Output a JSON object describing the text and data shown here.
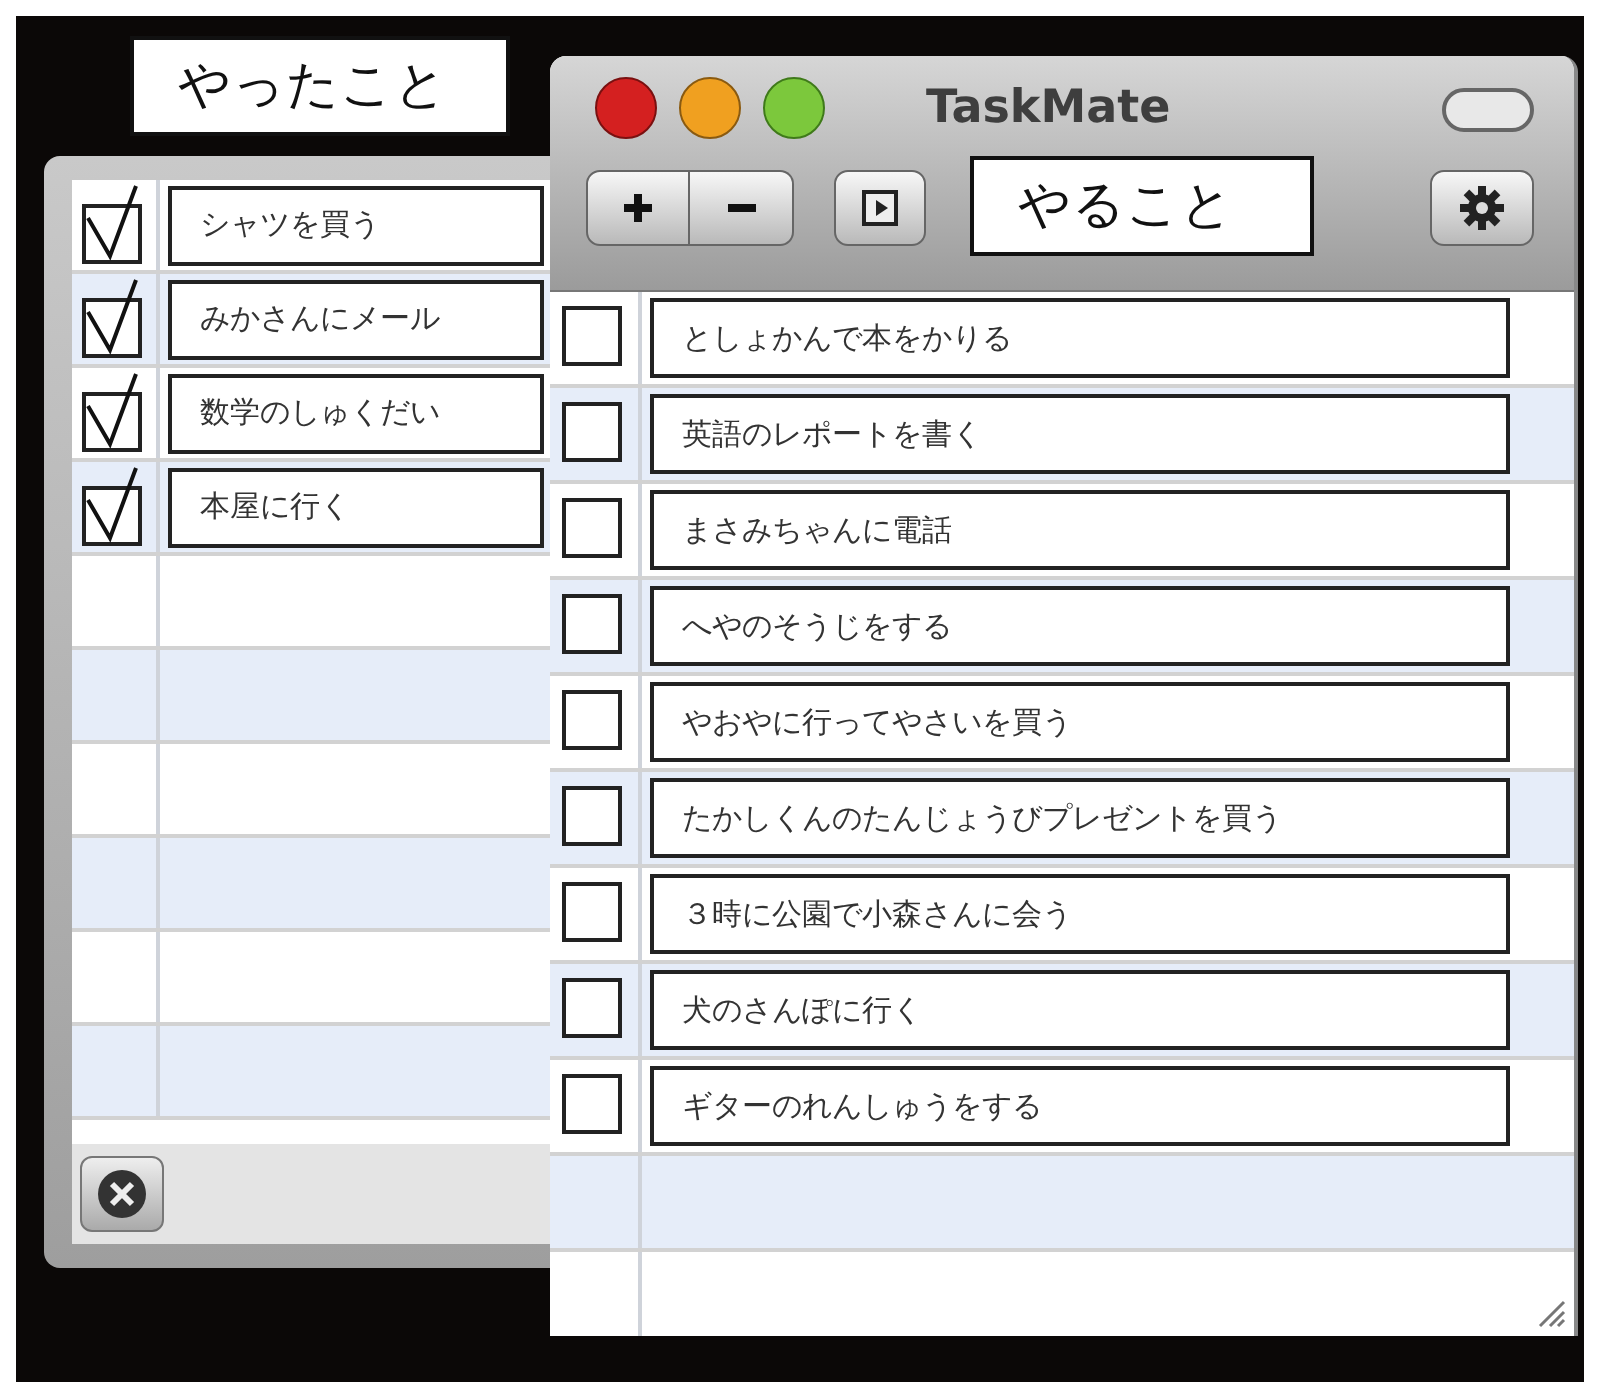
{
  "done_window": {
    "label": "やったこと",
    "items": [
      {
        "text": "シャツを買う",
        "checked": true
      },
      {
        "text": "みかさんにメール",
        "checked": true
      },
      {
        "text": "数学のしゅくだい",
        "checked": true
      },
      {
        "text": "本屋に行く",
        "checked": true
      }
    ]
  },
  "todo_window": {
    "title": "TaskMate",
    "label": "やること",
    "items": [
      {
        "text": "としょかんで本をかりる",
        "checked": false
      },
      {
        "text": "英語のレポートを書く",
        "checked": false
      },
      {
        "text": "まさみちゃんに電話",
        "checked": false
      },
      {
        "text": "へやのそうじをする",
        "checked": false
      },
      {
        "text": "やおやに行ってやさいを買う",
        "checked": false
      },
      {
        "text": "たかしくんのたんじょうびプレゼントを買う",
        "checked": false
      },
      {
        "text": "３時に公園で小森さんに会う",
        "checked": false
      },
      {
        "text": "犬のさんぽに行く",
        "checked": false
      },
      {
        "text": "ギターのれんしゅうをする",
        "checked": false
      }
    ]
  }
}
